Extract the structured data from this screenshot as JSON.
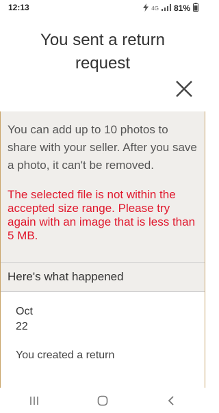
{
  "status_bar": {
    "time": "12:13",
    "network_label": "4G",
    "battery_text": "81%"
  },
  "header": {
    "title_line1": "You sent a return",
    "title_line2": "request",
    "close_icon": "close-icon"
  },
  "upload_info": {
    "text": "You can add up to 10 photos to share with your seller. After you save a photo, it can't be removed.",
    "error_text": "The selected file is not within the accepted size range. Please try again with an image that is less than 5 MB."
  },
  "history": {
    "heading": "Here's what happened",
    "entries": [
      {
        "month": "Oct",
        "day": "22",
        "event": "You created a return"
      }
    ]
  },
  "nav_bar": {
    "icons": [
      "recent-apps-icon",
      "home-icon",
      "back-icon"
    ]
  },
  "colors": {
    "error": "#e0182d",
    "panel_background": "#f0eeeb",
    "frame_border": "#c9a46a"
  }
}
